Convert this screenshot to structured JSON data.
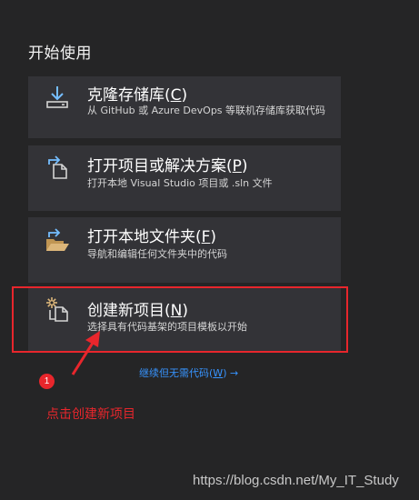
{
  "section_title": "开始使用",
  "cards": {
    "clone": {
      "label": "克隆存储库",
      "hotkey_open": "(",
      "hotkey": "C",
      "hotkey_close": ")",
      "description": "从 GitHub 或 Azure DevOps 等联机存储库获取代码"
    },
    "open_project": {
      "label": "打开项目或解决方案",
      "hotkey_open": "(",
      "hotkey": "P",
      "hotkey_close": ")",
      "description": "打开本地 Visual Studio 项目或 .sln 文件"
    },
    "open_folder": {
      "label": "打开本地文件夹",
      "hotkey_open": "(",
      "hotkey": "F",
      "hotkey_close": ")",
      "description": "导航和编辑任何文件夹中的代码"
    },
    "new_project": {
      "label": "创建新项目",
      "hotkey_open": "(",
      "hotkey": "N",
      "hotkey_close": ")",
      "description": "选择具有代码基架的项目模板以开始"
    }
  },
  "continue_link": {
    "text": "继续但无需代码",
    "hotkey_open": "(",
    "hotkey": "W",
    "hotkey_close": ")",
    "arrow": "→"
  },
  "annotation": {
    "step_number": "1",
    "text": "点击创建新项目"
  },
  "watermark": "https://blog.csdn.net/My_IT_Study",
  "colors": {
    "background": "#252526",
    "card": "#333337",
    "accent_link": "#3794ff",
    "annotation_red": "#e8262c",
    "icon_blue": "#75beff",
    "icon_folder": "#dcb67a"
  },
  "icons": {
    "clone": "download-icon",
    "open_project": "open-project-icon",
    "open_folder": "open-folder-icon",
    "new_project": "new-project-icon"
  }
}
